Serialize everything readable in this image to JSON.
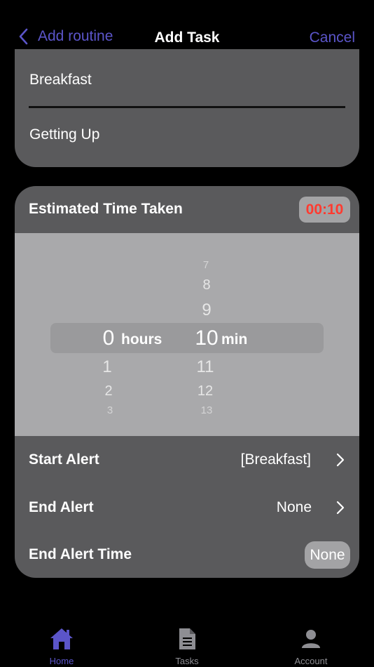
{
  "nav": {
    "back_label": "Add routine",
    "title": "Add Task",
    "cancel_label": "Cancel"
  },
  "names": {
    "task_name": "Breakfast",
    "routine_name": "Getting Up"
  },
  "time": {
    "label": "Estimated Time Taken",
    "badge": "00:10"
  },
  "picker": {
    "hours": {
      "above": [],
      "selected": "0",
      "below": [
        "1",
        "2",
        "3"
      ],
      "unit": "hours"
    },
    "minutes": {
      "above": [
        "7",
        "8",
        "9"
      ],
      "selected": "10",
      "below": [
        "11",
        "12",
        "13"
      ],
      "unit": "min"
    }
  },
  "rows": {
    "start_alert": {
      "label": "Start Alert",
      "value": "[Breakfast]"
    },
    "end_alert": {
      "label": "End Alert",
      "value": "None"
    },
    "end_alert_time": {
      "label": "End Alert Time",
      "value": "None"
    }
  },
  "tabs": [
    {
      "label": "Home",
      "icon": "house-icon",
      "active": true
    },
    {
      "label": "Tasks",
      "icon": "document-icon",
      "active": false
    },
    {
      "label": "Account",
      "icon": "person-icon",
      "active": false
    }
  ],
  "colors": {
    "accent": "#5b55c9",
    "badge_text": "#ff3b30",
    "card": "#5a5a5c",
    "picker_bg": "#a9a9ab"
  }
}
